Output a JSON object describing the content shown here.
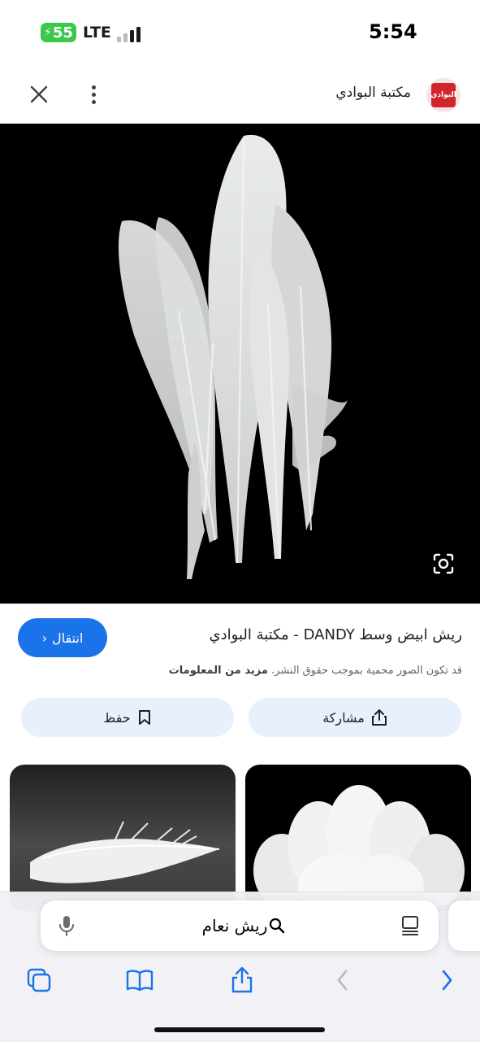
{
  "status_bar": {
    "battery": "55",
    "network": "LTE",
    "time": "5:54"
  },
  "top_bar": {
    "site_name": "مكتبة البوادي",
    "logo_text": "البوادي"
  },
  "result": {
    "visit_label": "انتقال",
    "title": "ريش ابيض وسط DANDY - مكتبة البوادي",
    "copyright_notice": "قد تكون الصور محمية بموجب حقوق النشر.",
    "more_info": "مزيد من المعلومات",
    "share_label": "مشاركة",
    "save_label": "حفظ"
  },
  "address_bar": {
    "query": "ريش نعام"
  },
  "colors": {
    "accent": "#1a73e8",
    "action_bg": "#e8f0fe",
    "battery": "#3cc84a",
    "logo": "#d0252b"
  }
}
